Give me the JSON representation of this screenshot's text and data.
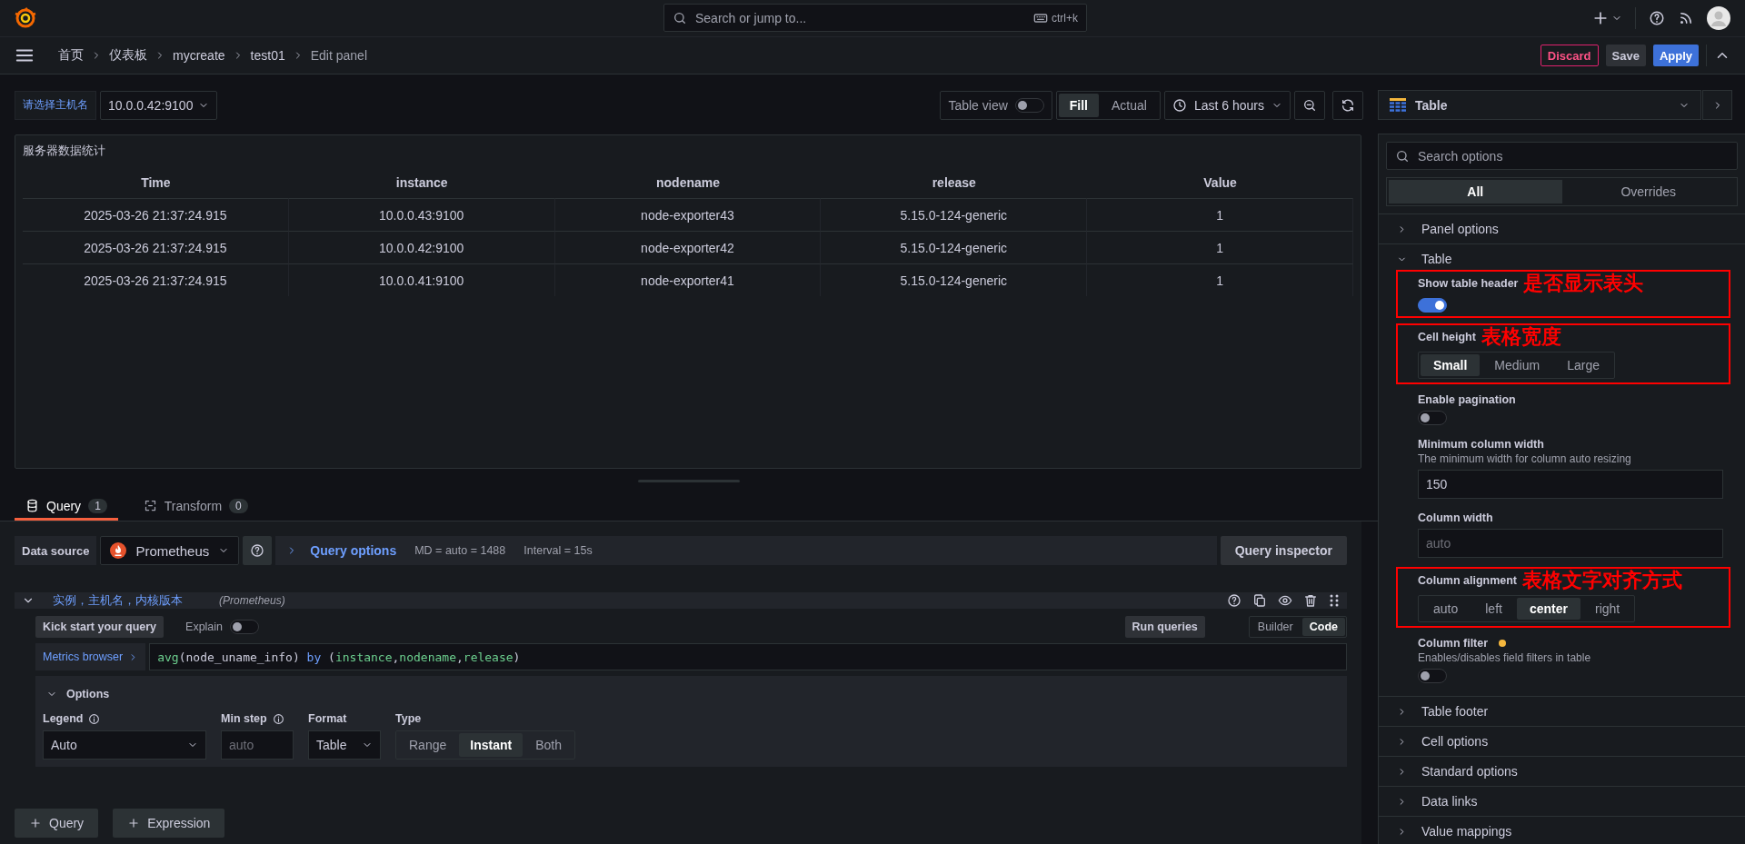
{
  "top_bar": {
    "search_placeholder": "Search or jump to...",
    "shortcut": "ctrl+k"
  },
  "breadcrumbs": [
    {
      "label": "首页",
      "current": false
    },
    {
      "label": "仪表板",
      "current": false
    },
    {
      "label": "mycreate",
      "current": false
    },
    {
      "label": "test01",
      "current": false
    },
    {
      "label": "Edit panel",
      "current": true
    }
  ],
  "actions": [
    {
      "label": "Discard",
      "kind": "destructive"
    },
    {
      "label": "Save",
      "kind": "secondary"
    },
    {
      "label": "Apply",
      "kind": "primary"
    }
  ],
  "variable": {
    "label": "请选择主机名",
    "value": "10.0.0.42:9100"
  },
  "panel_toolbar": {
    "table_view": {
      "label": "Table view",
      "on": false
    },
    "size_modes": [
      {
        "label": "Fill",
        "selected": true
      },
      {
        "label": "Actual",
        "selected": false
      }
    ],
    "time_range": "Last 6 hours"
  },
  "visualization": "Table",
  "panel": {
    "title": "服务器数据统计",
    "columns": [
      "Time",
      "instance",
      "nodename",
      "release",
      "Value"
    ],
    "rows": [
      [
        "2025-03-26 21:37:24.915",
        "10.0.0.43:9100",
        "node-exporter43",
        "5.15.0-124-generic",
        "1"
      ],
      [
        "2025-03-26 21:37:24.915",
        "10.0.0.42:9100",
        "node-exporter42",
        "5.15.0-124-generic",
        "1"
      ],
      [
        "2025-03-26 21:37:24.915",
        "10.0.0.41:9100",
        "node-exporter41",
        "5.15.0-124-generic",
        "1"
      ]
    ]
  },
  "query_tabs": [
    {
      "label": "Query",
      "count": "1",
      "selected": true
    },
    {
      "label": "Transform",
      "count": "0",
      "selected": false
    }
  ],
  "data_source": {
    "label": "Data source",
    "name": "Prometheus"
  },
  "query_options": {
    "label": "Query options",
    "max_data_points": "MD = auto = 1488",
    "interval": "Interval = 15s"
  },
  "query_inspector": "Query inspector",
  "query": {
    "name": "实例，主机名，内核版本",
    "datasource": "(Prometheus)",
    "expanded": true,
    "kick_start": "Kick start your query",
    "explain": {
      "label": "Explain",
      "on": false
    },
    "run": "Run queries",
    "modes": [
      {
        "label": "Builder",
        "selected": false
      },
      {
        "label": "Code",
        "selected": true
      }
    ],
    "metrics_browser": "Metrics browser",
    "expression": [
      {
        "text": "avg",
        "kind": "function"
      },
      {
        "text": "(node_uname_info) ",
        "kind": "plain"
      },
      {
        "text": "by",
        "kind": "keyword"
      },
      {
        "text": " (",
        "kind": "plain"
      },
      {
        "text": "instance",
        "kind": "label"
      },
      {
        "text": ",",
        "kind": "plain"
      },
      {
        "text": "nodename",
        "kind": "label"
      },
      {
        "text": ",",
        "kind": "plain"
      },
      {
        "text": "release",
        "kind": "label"
      },
      {
        "text": ")",
        "kind": "plain"
      }
    ],
    "options": {
      "label": "Options",
      "expanded": true,
      "legend": {
        "label": "Legend",
        "value": "Auto"
      },
      "min_step": {
        "label": "Min step",
        "placeholder": "auto"
      },
      "format": {
        "label": "Format",
        "value": "Table"
      },
      "type": {
        "label": "Type",
        "options": [
          {
            "label": "Range",
            "selected": false
          },
          {
            "label": "Instant",
            "selected": true
          },
          {
            "label": "Both",
            "selected": false
          }
        ]
      }
    }
  },
  "add_buttons": [
    "Query",
    "Expression"
  ],
  "options_pane": {
    "search_placeholder": "Search options",
    "tabs": [
      {
        "label": "All",
        "selected": true
      },
      {
        "label": "Overrides",
        "selected": false
      }
    ],
    "sections": [
      {
        "title": "Panel options",
        "expanded": false
      },
      {
        "title": "Table",
        "expanded": true,
        "items": [
          {
            "kind": "switch",
            "label": "Show table header",
            "on": true,
            "annotation": "是否显示表头"
          },
          {
            "kind": "radio",
            "label": "Cell height",
            "annotation": "表格宽度",
            "options": [
              {
                "label": "Small",
                "selected": true
              },
              {
                "label": "Medium",
                "selected": false
              },
              {
                "label": "Large",
                "selected": false
              }
            ]
          },
          {
            "kind": "switch",
            "label": "Enable pagination",
            "on": false
          },
          {
            "kind": "input",
            "label": "Minimum column width",
            "description": "The minimum width for column auto resizing",
            "value": "150"
          },
          {
            "kind": "input",
            "label": "Column width",
            "placeholder": "auto"
          },
          {
            "kind": "radio",
            "label": "Column alignment",
            "annotation": "表格文字对齐方式",
            "options": [
              {
                "label": "auto",
                "selected": false
              },
              {
                "label": "left",
                "selected": false
              },
              {
                "label": "center",
                "selected": true
              },
              {
                "label": "right",
                "selected": false
              }
            ]
          },
          {
            "kind": "switch",
            "label": "Column filter",
            "modified": true,
            "description": "Enables/disables field filters in table",
            "on": false
          }
        ]
      },
      {
        "title": "Table footer",
        "expanded": false
      },
      {
        "title": "Cell options",
        "expanded": false
      },
      {
        "title": "Standard options",
        "expanded": false
      },
      {
        "title": "Data links",
        "expanded": false
      },
      {
        "title": "Value mappings",
        "expanded": false
      }
    ]
  }
}
